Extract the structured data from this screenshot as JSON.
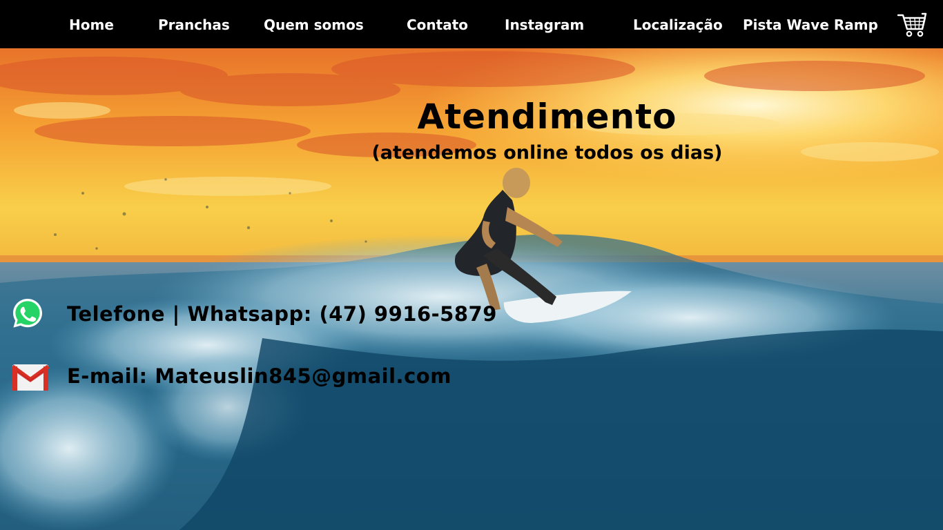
{
  "nav": {
    "items": [
      {
        "label": "Home"
      },
      {
        "label": "Pranchas"
      },
      {
        "label": "Quem somos"
      },
      {
        "label": "Contato"
      },
      {
        "label": "Instagram"
      },
      {
        "label": "Localização"
      },
      {
        "label": "Pista Wave Ramp"
      }
    ],
    "cart_icon": "shopping-cart-icon"
  },
  "hero": {
    "title": "Atendimento",
    "subtitle": "(atendemos online todos os dias)"
  },
  "contacts": {
    "phone": {
      "icon": "whatsapp-icon",
      "text": "Telefone  |  Whatsapp: (47) 9916-5879"
    },
    "email": {
      "icon": "gmail-icon",
      "text": "E-mail: Mateuslin845@gmail.com"
    }
  },
  "colors": {
    "navbar_bg": "#000000",
    "nav_text": "#ffffff",
    "heading_text": "#000000",
    "whatsapp_green": "#25D366",
    "gmail_red": "#D93025"
  }
}
